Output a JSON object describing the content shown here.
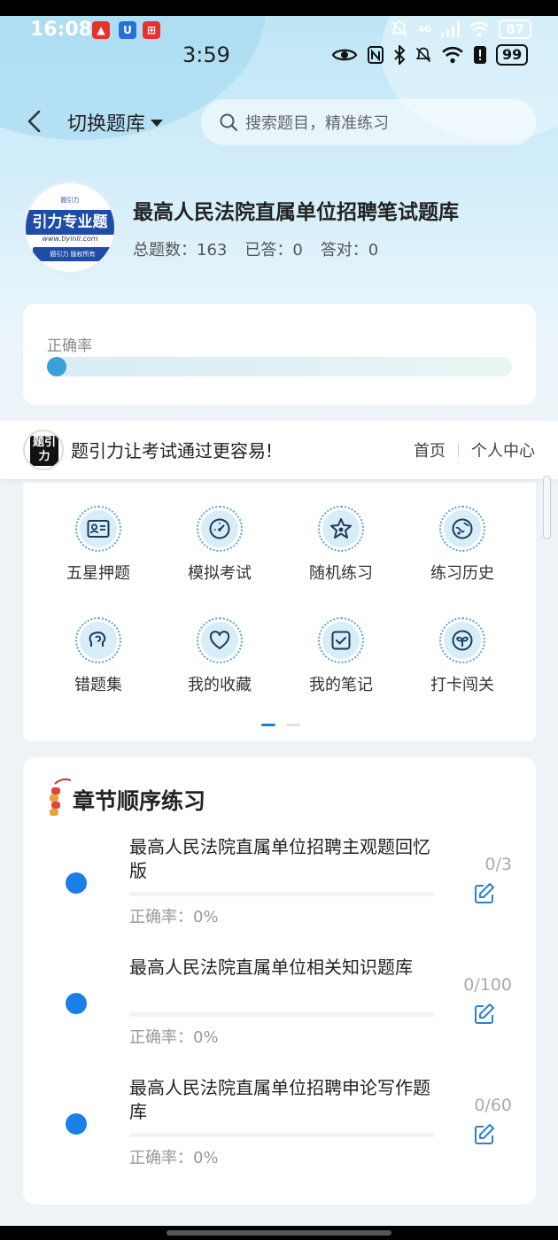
{
  "outer_status": {
    "time": "16:08",
    "network": "4G",
    "battery": "87"
  },
  "inner_status": {
    "time": "3:59",
    "battery": "99"
  },
  "nav": {
    "switch_label": "切换题库",
    "search_placeholder": "搜索题目，精准练习"
  },
  "bank": {
    "logo_text": "引力专业题",
    "logo_url": "www.tiyinli.com",
    "logo_footer": "题引力 版权所有",
    "logo_top": "题引力",
    "title": "最高人民法院直属单位招聘笔试题库",
    "total_label": "总题数：163",
    "answered_label": "已答：0",
    "correct_label": "答对：0"
  },
  "rate_card": {
    "label": "正确率",
    "value_percent": 0
  },
  "promo": {
    "logo_text": "题引力",
    "slogan": "题引力让考试通过更容易!",
    "home": "首页",
    "profile": "个人中心"
  },
  "grid": {
    "items": [
      {
        "label": "五星押题",
        "icon": "id-card-icon"
      },
      {
        "label": "模拟考试",
        "icon": "gauge-icon"
      },
      {
        "label": "随机练习",
        "icon": "random-star-icon"
      },
      {
        "label": "练习历史",
        "icon": "history-icon"
      },
      {
        "label": "错题集",
        "icon": "brain-icon"
      },
      {
        "label": "我的收藏",
        "icon": "heart-icon"
      },
      {
        "label": "我的笔记",
        "icon": "note-check-icon"
      },
      {
        "label": "打卡闯关",
        "icon": "sprout-icon"
      }
    ],
    "page_count": 2,
    "active_page": 1
  },
  "chapters": {
    "title": "章节顺序练习",
    "items": [
      {
        "name": "最高人民法院直属单位招聘主观题回忆版",
        "count": "0/3",
        "rate": "正确率：0%"
      },
      {
        "name": "最高人民法院直属单位相关知识题库",
        "count": "0/100",
        "rate": "正确率：0%"
      },
      {
        "name": "最高人民法院直属单位招聘申论写作题库",
        "count": "0/60",
        "rate": "正确率：0%"
      }
    ]
  },
  "colors": {
    "accent": "#1a7fe6",
    "hero_top": "#bfe6f6",
    "card": "#ffffff",
    "background": "#eef3f7"
  }
}
